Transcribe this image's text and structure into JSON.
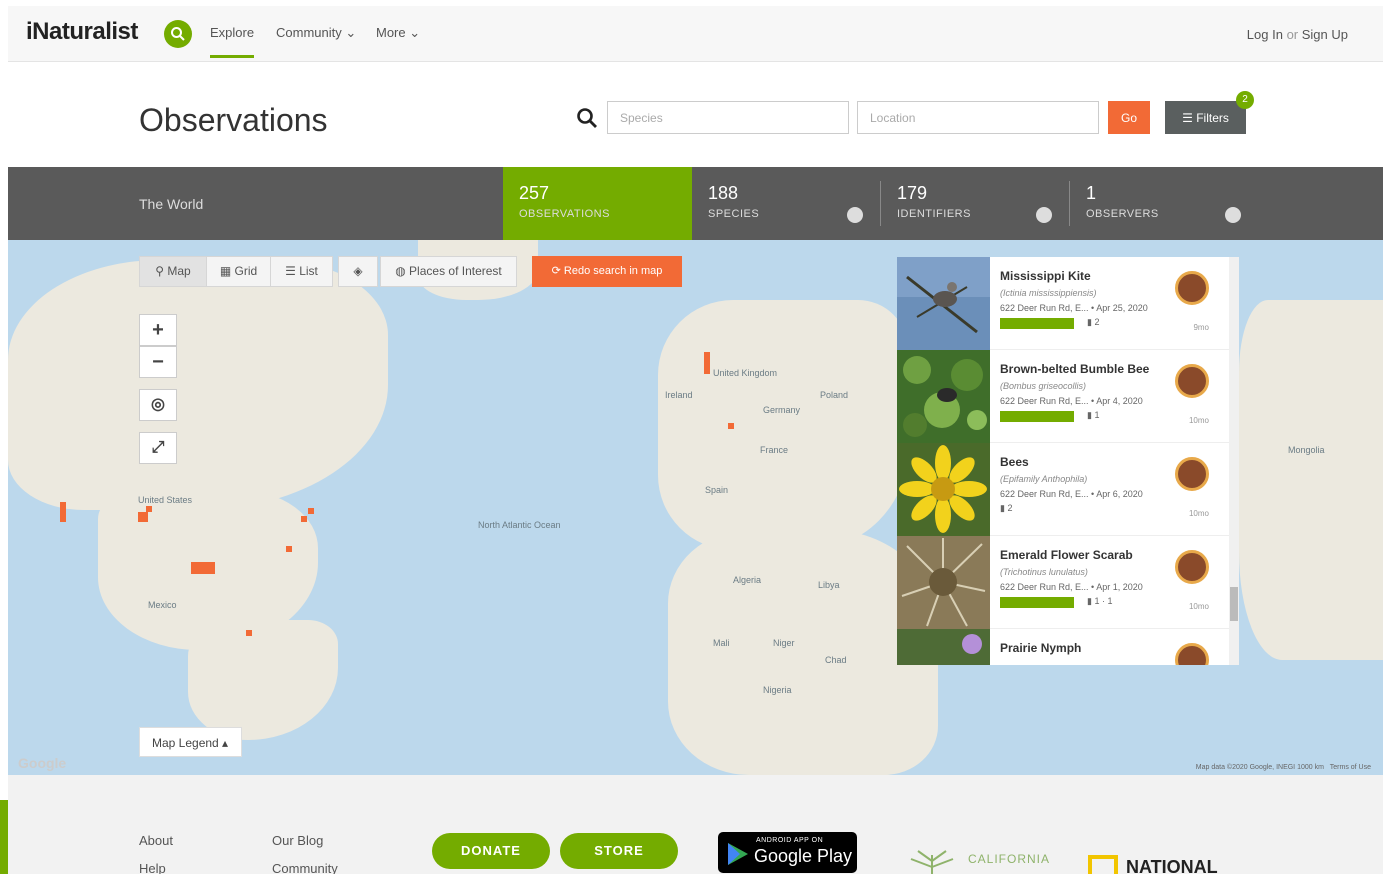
{
  "nav": {
    "logo": "iNaturalist",
    "explore": "Explore",
    "community": "Community",
    "more": "More",
    "login": "Log In",
    "or": "or",
    "signup": "Sign Up"
  },
  "header": {
    "title": "Observations",
    "species_placeholder": "Species",
    "location_placeholder": "Location",
    "go": "Go",
    "filters": "Filters",
    "filters_count": "2"
  },
  "stats": {
    "place": "The World",
    "observations": {
      "num": "257",
      "label": "OBSERVATIONS"
    },
    "species": {
      "num": "188",
      "label": "SPECIES"
    },
    "identifiers": {
      "num": "179",
      "label": "IDENTIFIERS"
    },
    "observers": {
      "num": "1",
      "label": "OBSERVERS"
    }
  },
  "map": {
    "view_map": "Map",
    "view_grid": "Grid",
    "view_list": "List",
    "places": "Places of Interest",
    "redo": "Redo search in map",
    "zoom_in": "+",
    "zoom_out": "−",
    "legend": "Map Legend ▴",
    "attribution": "Map data ©2020 Google, INEGI    1000 km",
    "terms": "Terms of Use",
    "google": "Google",
    "labels": {
      "north_atlantic": "North Atlantic Ocean",
      "united_states": "United States",
      "mexico": "Mexico",
      "ireland": "Ireland",
      "united_kingdom": "United Kingdom",
      "france": "France",
      "spain": "Spain",
      "germany": "Germany",
      "poland": "Poland",
      "algeria": "Algeria",
      "libya": "Libya",
      "mali": "Mali",
      "niger": "Niger",
      "chad": "Chad",
      "nigeria": "Nigeria",
      "mongolia": "Mongolia"
    }
  },
  "observations": [
    {
      "name": "Mississippi Kite",
      "sci": "(Ictinia mississippiensis)",
      "place": "622 Deer Run Rd, E...",
      "date": "Apr 25, 2020",
      "meta": "2",
      "ago": "9mo",
      "rg": true
    },
    {
      "name": "Brown-belted Bumble Bee",
      "sci": "(Bombus griseocollis)",
      "place": "622 Deer Run Rd, E...",
      "date": "Apr 4, 2020",
      "meta": "1",
      "ago": "10mo",
      "rg": true
    },
    {
      "name": "Bees",
      "sci": "(Epifamily Anthophila)",
      "place": "622 Deer Run Rd, E...",
      "date": "Apr 6, 2020",
      "meta": "2",
      "ago": "10mo",
      "rg": false
    },
    {
      "name": "Emerald Flower Scarab",
      "sci": "(Trichotinus lunulatus)",
      "place": "622 Deer Run Rd, E...",
      "date": "Apr 1, 2020",
      "meta": "1 · 1",
      "ago": "10mo",
      "rg": true
    },
    {
      "name": "Prairie Nymph",
      "sci": "",
      "place": "",
      "date": "",
      "meta": "",
      "ago": "",
      "rg": false
    }
  ],
  "footer": {
    "about": "About",
    "help": "Help",
    "blog": "Our Blog",
    "community": "Community",
    "donate": "DONATE",
    "store": "STORE",
    "gplay_small": "ANDROID APP ON",
    "gplay_big": "Google Play",
    "cal": "CALIFORNIA",
    "natgeo": "NATIONAL"
  },
  "colors": {
    "accent": "#74ac00",
    "orange": "#f26a36",
    "statsbar": "#5a5a5a"
  }
}
